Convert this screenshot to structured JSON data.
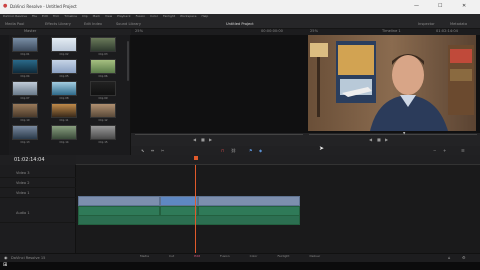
{
  "window": {
    "title": "DaVinci Resolve - Untitled Project"
  },
  "menu": [
    "DaVinci Resolve",
    "File",
    "Edit",
    "Trim",
    "Timeline",
    "Clip",
    "Mark",
    "View",
    "Playback",
    "Fusion",
    "Color",
    "Fairlight",
    "Workspace",
    "Help"
  ],
  "toolbar": {
    "media_pool": "Media Pool",
    "effects_library": "Effects Library",
    "edit_index": "Edit Index",
    "sound_library": "Sound Library",
    "project_name": "Untitled Project",
    "inspector": "Inspector",
    "metadata": "Metadata"
  },
  "media_pool": {
    "bins": "Master",
    "clips": [
      {
        "name": "Clip 01"
      },
      {
        "name": "Clip 02"
      },
      {
        "name": "Clip 03"
      },
      {
        "name": "Clip 04"
      },
      {
        "name": "Clip 05"
      },
      {
        "name": "Clip 06"
      },
      {
        "name": "Clip 07"
      },
      {
        "name": "Clip 08"
      },
      {
        "name": "Clip 09"
      },
      {
        "name": "Clip 10"
      },
      {
        "name": "Clip 11"
      },
      {
        "name": "Clip 12"
      },
      {
        "name": "Clip 13"
      },
      {
        "name": "Clip 14"
      },
      {
        "name": "Clip 15"
      }
    ]
  },
  "viewers": {
    "source_zoom": "25%",
    "source_timecode": "00:00:00:00",
    "timeline_zoom": "25%",
    "timeline_name": "Timeline 1",
    "timeline_timecode": "01:02:14:04"
  },
  "timeline": {
    "timecode": "01:02:14:04",
    "tracks": [
      {
        "label": "Video 3"
      },
      {
        "label": "Video 2"
      },
      {
        "label": "Video 1"
      },
      {
        "label": "Audio 1"
      }
    ]
  },
  "pages": [
    "Media",
    "Cut",
    "Edit",
    "Fusion",
    "Color",
    "Fairlight",
    "Deliver"
  ],
  "status": {
    "app": "DaVinci Resolve 15"
  }
}
